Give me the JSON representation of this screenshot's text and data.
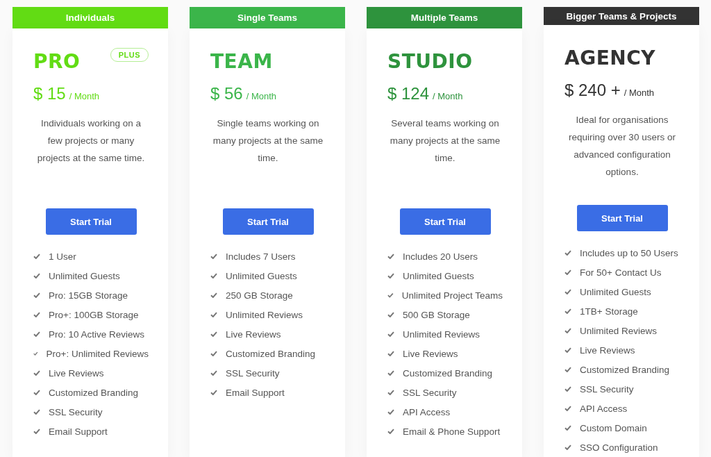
{
  "plans": [
    {
      "audience": "Individuals",
      "color": "#62dc14",
      "name": "PRO",
      "badge": "PLUS",
      "price": "$ 15",
      "period": "/ Month",
      "description": "Individuals working on a few projects or many projects at the same time.",
      "button": "Start Trial",
      "features": [
        "1 User",
        "Unlimited Guests",
        "Pro: 15GB Storage",
        "Pro+: 100GB Storage",
        "Pro: 10 Active Reviews",
        "Pro+: Unlimited Reviews",
        "Live Reviews",
        "Customized Branding",
        "SSL Security",
        "Email Support"
      ]
    },
    {
      "audience": "Single Teams",
      "color": "#3bb54a",
      "name": "TEAM",
      "price": "$ 56",
      "period": "/ Month",
      "description": "Single teams working on many projects at the same time.",
      "button": "Start Trial",
      "features": [
        "Includes 7 Users",
        "Unlimited Guests",
        "250 GB Storage",
        "Unlimited Reviews",
        "Live Reviews",
        "Customized Branding",
        "SSL Security",
        "Email Support"
      ]
    },
    {
      "audience": "Multiple Teams",
      "color": "#2e933d",
      "name": "STUDIO",
      "price": "$ 124",
      "period": "/ Month",
      "description": "Several teams working on many projects at the same time.",
      "button": "Start Trial",
      "features": [
        "Includes 20 Users",
        "Unlimited Guests",
        "Unlimited Project Teams",
        "500 GB Storage",
        "Unlimited Reviews",
        "Live Reviews",
        "Customized Branding",
        "SSL Security",
        "API Access",
        "Email & Phone Support"
      ]
    },
    {
      "audience": "Bigger Teams & Projects",
      "color": "#333333",
      "name": "AGENCY",
      "price": "$ 240 +",
      "period": "/ Month",
      "description": "Ideal for organisations requiring over 30 users or advanced configuration options.",
      "button": "Start Trial",
      "features": [
        "Includes up to 50 Users",
        "For 50+ Contact Us",
        "Unlimited Guests",
        "1TB+ Storage",
        "Unlimited Reviews",
        "Live Reviews",
        "Customized Branding",
        "SSL Security",
        "API Access",
        "Custom Domain",
        "SSO Configuration"
      ]
    }
  ]
}
